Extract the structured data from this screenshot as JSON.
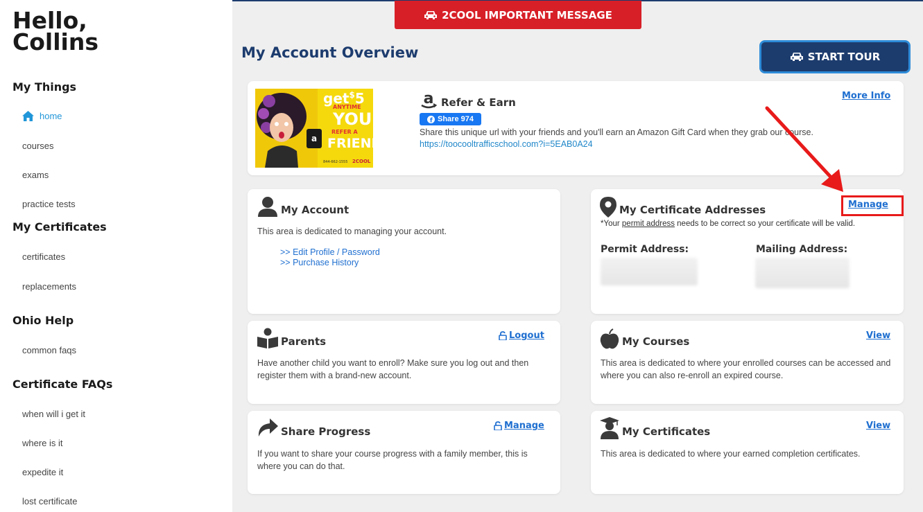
{
  "sidebar": {
    "greeting_line1": "Hello,",
    "greeting_line2": "Collins",
    "sections": [
      {
        "title": "My Things",
        "items": [
          "home",
          "courses",
          "exams",
          "practice tests"
        ]
      },
      {
        "title": "My Certificates",
        "items": [
          "certificates",
          "replacements"
        ]
      },
      {
        "title": "Ohio Help",
        "items": [
          "common faqs"
        ]
      },
      {
        "title": "Certificate FAQs",
        "items": [
          "when will i get it",
          "where is it",
          "expedite it",
          "lost certificate"
        ]
      }
    ]
  },
  "header": {
    "message_button": "2COOL IMPORTANT MESSAGE",
    "page_title": "My Account Overview",
    "tour_button": "START TOUR"
  },
  "refer": {
    "title": "Refer & Earn",
    "more_info": "More Info",
    "share_label": "Share 974",
    "description": "Share this unique url with your friends and you'll earn an Amazon Gift Card when they grab our course.",
    "url": "https://toocooltrafficschool.com?i=5EAB0A24",
    "promo": {
      "get": "get",
      "amount": "5",
      "anytime": "ANYTIME",
      "you": "YOU",
      "refer": "REFER A",
      "friend": "FRIEND",
      "phone": "844-662-1555",
      "brand": "2COOL"
    }
  },
  "account": {
    "title": "My Account",
    "description": "This area is dedicated to managing your account.",
    "link1": ">> Edit Profile / Password",
    "link2": ">> Purchase History"
  },
  "addresses": {
    "title": "My Certificate Addresses",
    "manage": "Manage",
    "note_prefix": "*Your ",
    "note_link": "permit address",
    "note_suffix": " needs to be correct so your certificate will be valid.",
    "permit_label": "Permit Address:",
    "mailing_label": "Mailing Address:"
  },
  "parents": {
    "title": "Parents",
    "logout": "Logout",
    "description": "Have another child you want to enroll? Make sure you log out and then register them with a brand-new account."
  },
  "courses": {
    "title": "My Courses",
    "view": "View",
    "description": "This area is dedicated to where your enrolled courses can be accessed and where you can also re-enroll an expired course."
  },
  "share_progress": {
    "title": "Share Progress",
    "manage": "Manage",
    "description": "If you want to share your course progress with a family member, this is where you can do that."
  },
  "certificates": {
    "title": "My Certificates",
    "view": "View",
    "description": "This area is dedicated to where your earned completion certificates."
  },
  "colors": {
    "navy": "#1d3c6e",
    "red": "#d71f27",
    "link": "#1f6fd0",
    "accent": "#2e8bd8"
  }
}
